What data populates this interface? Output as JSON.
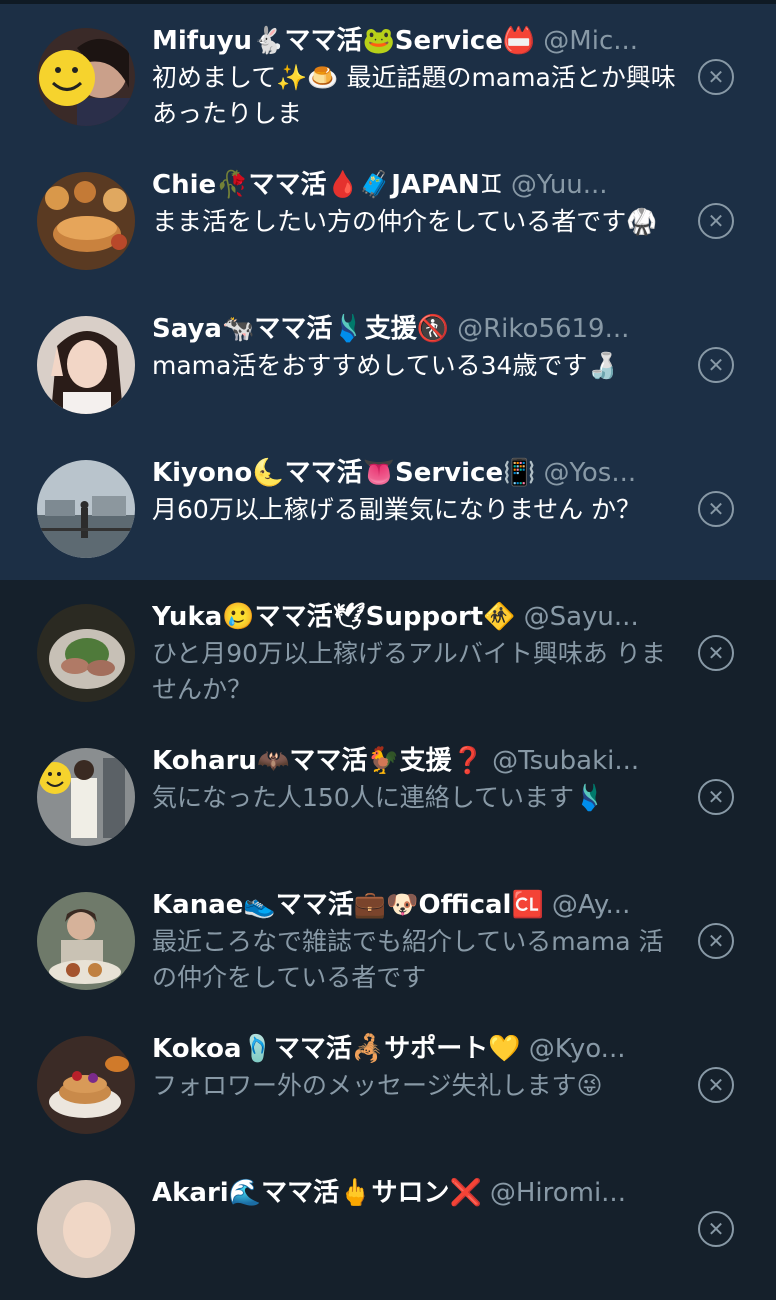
{
  "dismiss_glyph": "✕",
  "requests": [
    {
      "name": "Mifuyu🐇ママ活🐸Service📛",
      "handle": "@Mic...",
      "message": "初めまして✨🍮\n最近話題のmama活とか興味あったりしま",
      "unread": true,
      "avatar": "smiley-woman-photo"
    },
    {
      "name": "Chie🥀ママ活🩸🧳JAPAN♊",
      "handle": "@Yuu...",
      "message": "まま活をしたい方の仲介をしている者です🥋",
      "unread": true,
      "avatar": "pastries-photo"
    },
    {
      "name": "Saya🐄ママ活🩱支援🚷",
      "handle": "@Riko5619...",
      "message": "mama活をおすすめしている34歳です🍶",
      "unread": true,
      "avatar": "peace-sign-woman-photo"
    },
    {
      "name": "Kiyono🌜ママ活👅Service📳",
      "handle": "@Yos...",
      "message": "月60万以上稼げる副業気になりません か？",
      "unread": true,
      "avatar": "harbor-person-photo"
    },
    {
      "name": "Yuka🥲ママ活🕊Support🚸",
      "handle": "@Sayu...",
      "message": "ひと月90万以上稼げるアルバイト興味あ りませんか？",
      "unread": false,
      "avatar": "food-plate-photo"
    },
    {
      "name": "Koharu🦇ママ活🐓支援❓",
      "handle": "@Tsubaki...",
      "message": "気になった人150人に連絡しています🩱",
      "unread": false,
      "avatar": "smiley-mirror-selfie-photo"
    },
    {
      "name": "Kanae👟ママ活💼🐶Offical🆑",
      "handle": "@Ay...",
      "message": "最近ころなで雑誌でも紹介しているmama 活の仲介をしている者です",
      "unread": false,
      "avatar": "woman-dining-photo"
    },
    {
      "name": "Kokoa🩴ママ活🦂サポート💛",
      "handle": "@Kyo...",
      "message": "フォロワー外のメッセージ失礼します😜",
      "unread": false,
      "avatar": "dessert-photo"
    },
    {
      "name": "Akari🌊ママ活🖕サロン❌",
      "handle": "@Hiromi...",
      "message": "",
      "unread": false,
      "avatar": "portrait-photo"
    }
  ]
}
